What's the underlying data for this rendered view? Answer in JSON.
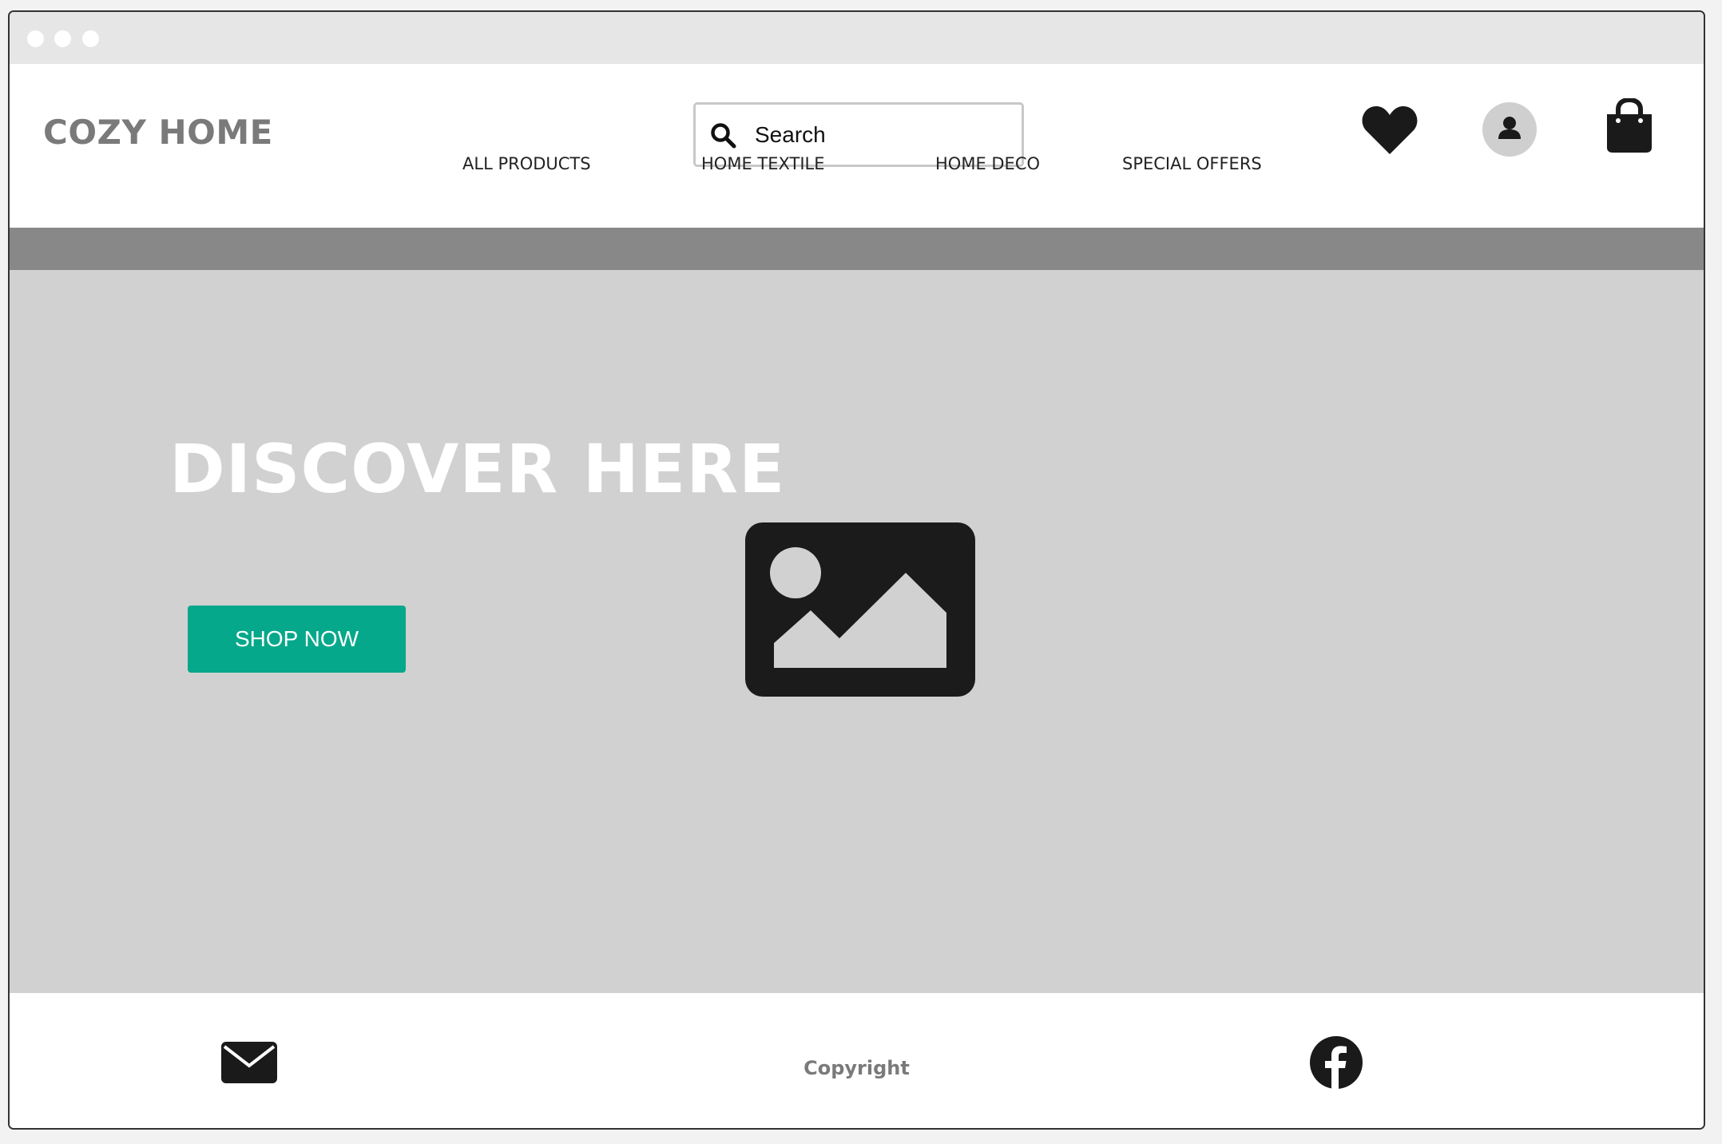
{
  "brand": {
    "name": "COZY HOME"
  },
  "search": {
    "placeholder": "Search",
    "icon": "search-icon"
  },
  "header_icons": {
    "wishlist": "heart-icon",
    "account": "user-icon",
    "cart": "shopping-bag-icon"
  },
  "nav": {
    "items": [
      {
        "label": "ALL PRODUCTS"
      },
      {
        "label": "HOME TEXTILE"
      },
      {
        "label": "HOME DECO"
      },
      {
        "label": "SPECIAL OFFERS"
      }
    ]
  },
  "hero": {
    "title": "DISCOVER HERE",
    "cta_label": "SHOP NOW",
    "image_icon": "image-placeholder-icon"
  },
  "footer": {
    "copyright": "Copyright",
    "email_icon": "envelope-icon",
    "social_icon": "facebook-icon"
  },
  "colors": {
    "accent": "#05a88a",
    "brand_text": "#7a7a7a",
    "hero_bg": "#d1d1d1",
    "strip_bg": "#888888"
  }
}
